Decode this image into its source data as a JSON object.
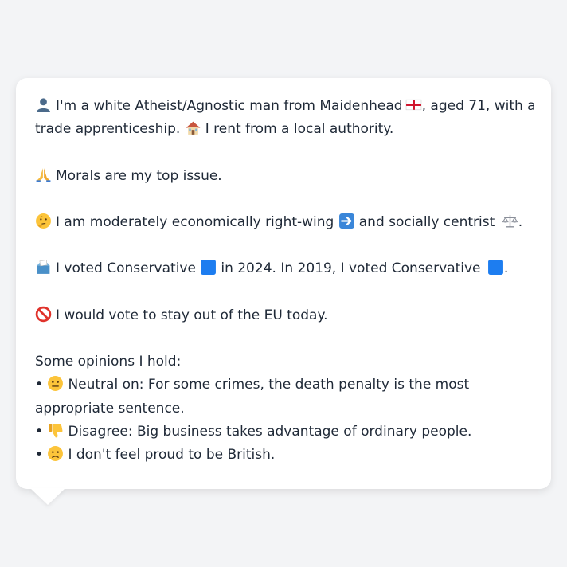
{
  "bio": {
    "line1_a": "I'm a white Atheist/Agnostic man from Maidenhead",
    "line1_b": ", aged 71, with a",
    "line2_a": "trade apprenticeship.",
    "line2_b": "I rent from a local authority."
  },
  "issue": {
    "text": "Morals are my top issue."
  },
  "ideology": {
    "text_a": "I am moderately economically right-wing",
    "text_b": "and socially centrist",
    "text_c": "."
  },
  "vote": {
    "text_a": "I voted Conservative",
    "text_b": "in 2024. In 2019, I voted Conservative",
    "text_c": "."
  },
  "eu": {
    "text": "I would vote to stay out of the EU today."
  },
  "opinions": {
    "heading": "Some opinions I hold:",
    "bullet": "•",
    "items": [
      {
        "text": "Neutral on: For some crimes, the death penalty is the most appropriate sentence."
      },
      {
        "text": "Disagree: Big business takes advantage of ordinary people."
      },
      {
        "text": "I don't feel proud to be British."
      }
    ]
  },
  "icons": {
    "person": "bust-in-silhouette-icon",
    "flag": "england-flag-icon",
    "house": "house-icon",
    "pray": "folded-hands-icon",
    "thinking": "thinking-face-icon",
    "arrow": "right-arrow-icon",
    "scales": "balance-scale-icon",
    "ballot": "ballot-box-icon",
    "blue_square": "blue-square-icon",
    "no_entry": "prohibited-icon",
    "neutral_face": "neutral-face-icon",
    "thumbs_down": "thumbs-down-icon",
    "frown": "slightly-frowning-face-icon"
  },
  "colors": {
    "background": "#f3f4f6",
    "card": "#ffffff",
    "text": "#1f2937",
    "conservative_blue": "#1d7df0"
  }
}
